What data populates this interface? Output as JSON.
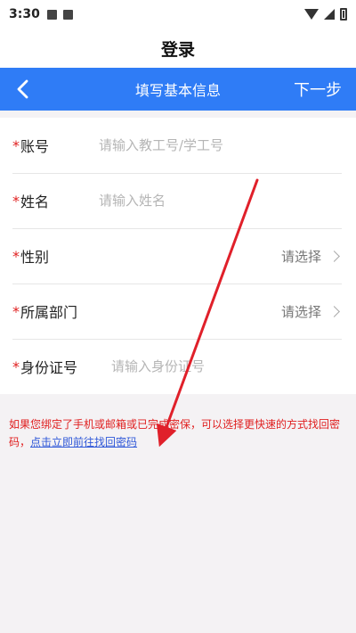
{
  "status_bar": {
    "time": "3:30",
    "icons": [
      "image-icon",
      "text-a-icon",
      "wifi-icon",
      "signal-icon",
      "battery-icon"
    ]
  },
  "page_title": "登录",
  "nav": {
    "back_icon": "back-chevron-icon",
    "title": "填写基本信息",
    "next_label": "下一步",
    "color": "#2f7cf6"
  },
  "form": {
    "required_mark": "*",
    "account": {
      "label": "账号",
      "placeholder": "请输入教工号/学工号",
      "value": ""
    },
    "name": {
      "label": "姓名",
      "placeholder": "请输入姓名",
      "value": ""
    },
    "gender": {
      "label": "性别",
      "value": "请选择"
    },
    "department": {
      "label": "所属部门",
      "value": "请选择"
    },
    "id_number": {
      "label": "身份证号",
      "placeholder": "请输入身份证号",
      "value": ""
    }
  },
  "notice": {
    "text": "如果您绑定了手机或邮箱或已完成密保，可以选择更快速的方式找回密码，",
    "link_text": "点击立即前往找回密码",
    "text_color": "#e02020"
  },
  "annotation": {
    "color": "#e0202a"
  }
}
